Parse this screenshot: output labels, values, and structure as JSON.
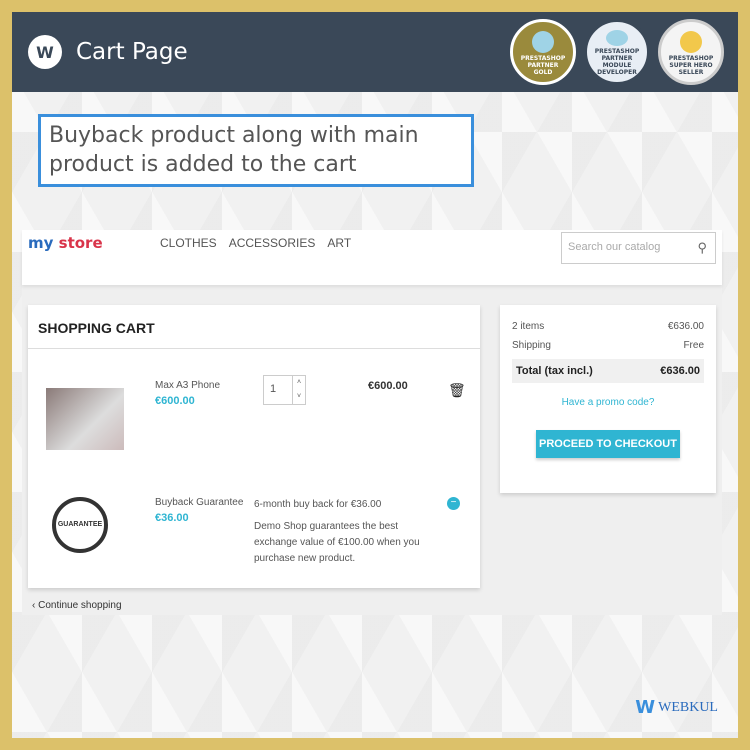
{
  "header": {
    "title": "Cart Page",
    "badges": [
      "PRESTASHOP PARTNER GOLD",
      "PRESTASHOP PARTNER MODULE DEVELOPER",
      "PRESTASHOP SUPER HERO SELLER"
    ]
  },
  "callout": "Buyback product along with main product is added to the cart",
  "store": {
    "logo_a": "my ",
    "logo_b": "store",
    "nav": [
      "CLOTHES",
      "ACCESSORIES",
      "ART"
    ],
    "search_placeholder": "Search our catalog"
  },
  "cart": {
    "title": "SHOPPING CART",
    "items": [
      {
        "name": "Max A3 Phone",
        "price": "€600.00",
        "qty": "1",
        "total": "€600.00"
      },
      {
        "name": "Buyback Guarantee",
        "price": "€36.00",
        "offer": "6-month buy back for €36.00",
        "desc": "Demo Shop guarantees the best exchange value of €100.00 when you purchase new product."
      }
    ],
    "continue": "Continue shopping"
  },
  "summary": {
    "items_label": "2 items",
    "items_value": "€636.00",
    "shipping_label": "Shipping",
    "shipping_value": "Free",
    "total_label": "Total (tax incl.)",
    "total_value": "€636.00",
    "promo": "Have a promo code?",
    "checkout": "PROCEED TO CHECKOUT"
  },
  "brand": "WEBKUL"
}
